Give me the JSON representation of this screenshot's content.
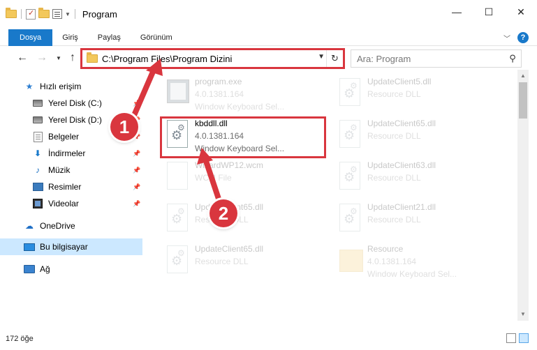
{
  "window": {
    "title": "Program",
    "minimize_glyph": "—",
    "maximize_glyph": "☐",
    "close_glyph": "✕"
  },
  "ribbon": {
    "tabs": [
      "Dosya",
      "Giriş",
      "Paylaş",
      "Görünüm"
    ],
    "accent": "#1979ca",
    "help_label": "?"
  },
  "nav": {
    "address": "C:\\Program Files\\Program Dizini",
    "search_placeholder": "Ara: Program"
  },
  "sidebar": {
    "items": [
      {
        "label": "Hızlı erişim",
        "icon": "star-icon"
      },
      {
        "label": "Yerel Disk (C:)",
        "icon": "disk-icon",
        "pinned": true
      },
      {
        "label": "Yerel Disk (D:)",
        "icon": "disk-icon",
        "pinned": true
      },
      {
        "label": "Belgeler",
        "icon": "documents-icon",
        "pinned": true
      },
      {
        "label": "İndirmeler",
        "icon": "download-icon",
        "pinned": true
      },
      {
        "label": "Müzik",
        "icon": "music-icon",
        "pinned": true
      },
      {
        "label": "Resimler",
        "icon": "pictures-icon",
        "pinned": true
      },
      {
        "label": "Videolar",
        "icon": "video-icon",
        "pinned": true
      },
      {
        "label": "OneDrive",
        "icon": "cloud-icon"
      },
      {
        "label": "Bu bilgisayar",
        "icon": "pc-icon",
        "selected": true
      },
      {
        "label": "Ağ",
        "icon": "network-icon"
      }
    ]
  },
  "files": [
    {
      "name": "program.exe",
      "line2": "4.0.1381.164",
      "line3": "Window Keyboard Sel...",
      "icon": "exe-icon",
      "faded": true
    },
    {
      "name": "UpdateClient5.dll",
      "line2": "Resource DLL",
      "icon": "dll-icon",
      "faded": true
    },
    {
      "name": "kbddll.dll",
      "line2": "4.0.1381.164",
      "line3": "Window Keyboard Sel...",
      "icon": "dll-icon",
      "faded": false,
      "highlighted": true
    },
    {
      "name": "UpdateClient65.dll",
      "line2": "Resource DLL",
      "icon": "dll-icon",
      "faded": true
    },
    {
      "name": "WizardWP12.wcm",
      "line2": "WCM File",
      "icon": "file-icon",
      "faded": true
    },
    {
      "name": "UpdateClient63.dll",
      "line2": "Resource DLL",
      "icon": "dll-icon",
      "faded": true
    },
    {
      "name": "UpdateClient65.dll",
      "line2": "Resource DLL",
      "icon": "dll-icon",
      "faded": true
    },
    {
      "name": "UpdateClient21.dll",
      "line2": "Resource DLL",
      "icon": "dll-icon",
      "faded": true
    },
    {
      "name": "UpdateClient65.dll",
      "line2": "Resource DLL",
      "icon": "dll-icon",
      "faded": true
    },
    {
      "name": "Resource",
      "line2": "4.0.1381.164",
      "line3": "Window Keyboard Sel...",
      "icon": "folder-icon",
      "faded": true
    }
  ],
  "status": {
    "item_count": "172 öğe"
  },
  "callouts": {
    "one": "1",
    "two": "2",
    "color": "#d9363e"
  }
}
